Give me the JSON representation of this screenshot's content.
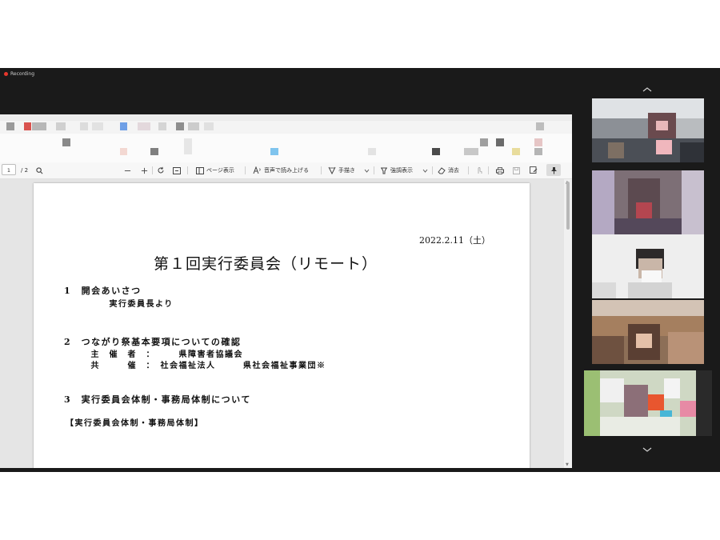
{
  "recording": {
    "label": "Recording"
  },
  "toolbar": {
    "page_current": "1",
    "page_total": "/ 2",
    "page_view_label": "ページ表示",
    "read_aloud_label": "音声で読み上げる",
    "draw_label": "手描き",
    "highlight_label": "強調表示",
    "erase_label": "消去"
  },
  "document": {
    "date": "2022.2.11（土）",
    "title": "第１回実行委員会（リモート）",
    "sections": [
      {
        "heading": "1　開会あいさつ",
        "lines": [
          "　　　実行委員長より"
        ]
      },
      {
        "heading": "2　つながり祭基本要項についての確認",
        "lines": [
          "　主　催　者　：　　　県障害者協議会",
          "　共　　　催　：　社会福祉法人　　　県社会福祉事業団※"
        ]
      },
      {
        "heading": "3　実行委員会体制・事務局体制について",
        "lines": [
          "【実行委員会体制・事務局体制】"
        ]
      }
    ]
  },
  "icons": [
    "zoom-out-icon",
    "zoom-in-icon",
    "rotate-icon",
    "fit-icon",
    "page-view-icon",
    "read-aloud-icon",
    "draw-icon",
    "highlight-icon",
    "erase-icon",
    "touch-icon",
    "print-icon",
    "save-icon",
    "save-as-icon",
    "pin-icon",
    "search-icon"
  ],
  "colors": {
    "app_bg": "#1a1a1a",
    "recording_dot": "#e8372c",
    "toolbar_bg": "#f7f7f7",
    "viewer_bg": "#e5e5e5"
  }
}
